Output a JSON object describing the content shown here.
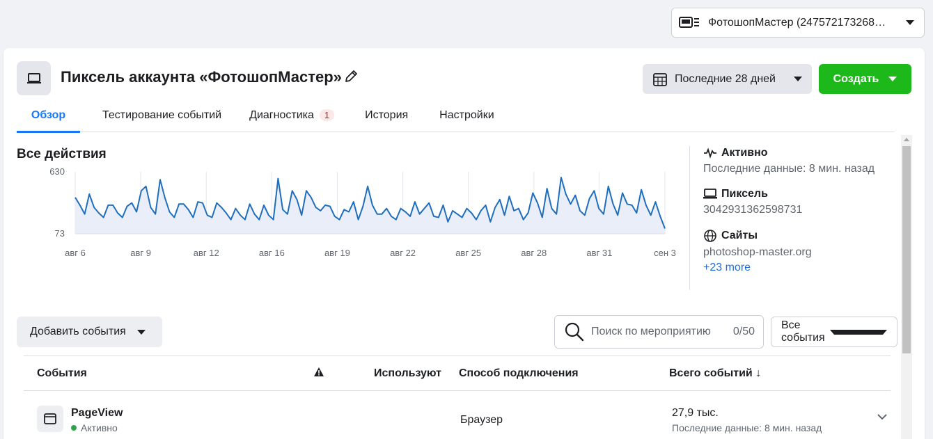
{
  "account_selector": {
    "label": "ФотошопМастер (247572173268…"
  },
  "header": {
    "title": "Пиксель аккаунта «ФотошопМастер»",
    "date_range": "Последние 28 дней",
    "create_label": "Создать"
  },
  "tabs": [
    {
      "label": "Обзор",
      "active": true
    },
    {
      "label": "Тестирование событий"
    },
    {
      "label": "Диагностика",
      "badge": "1"
    },
    {
      "label": "История"
    },
    {
      "label": "Настройки"
    }
  ],
  "chart_data": {
    "type": "area",
    "title": "Все действия",
    "ylim": [
      73,
      630
    ],
    "ytick_labels": [
      "630",
      "73"
    ],
    "xtick_labels": [
      "авг 6",
      "авг 9",
      "авг 12",
      "авг 16",
      "авг 19",
      "авг 22",
      "авг 25",
      "авг 28",
      "авг 31",
      "сен 3"
    ],
    "line_color": "#1f6ebd",
    "fill_color": "#e9eef9",
    "values": [
      400,
      330,
      250,
      430,
      310,
      260,
      220,
      330,
      330,
      260,
      220,
      320,
      350,
      270,
      460,
      500,
      310,
      250,
      560,
      400,
      270,
      220,
      340,
      340,
      290,
      220,
      360,
      350,
      240,
      220,
      350,
      310,
      260,
      200,
      300,
      240,
      200,
      340,
      250,
      200,
      330,
      240,
      200,
      570,
      290,
      250,
      460,
      380,
      240,
      460,
      400,
      310,
      280,
      330,
      320,
      230,
      200,
      290,
      270,
      360,
      200,
      320,
      500,
      330,
      250,
      250,
      300,
      230,
      200,
      300,
      270,
      230,
      360,
      250,
      300,
      350,
      230,
      220,
      330,
      180,
      280,
      250,
      220,
      300,
      260,
      200,
      280,
      330,
      180,
      310,
      380,
      240,
      410,
      280,
      300,
      200,
      260,
      440,
      350,
      220,
      480,
      300,
      250,
      580,
      430,
      340,
      420,
      280,
      240,
      390,
      460,
      300,
      250,
      500,
      340,
      240,
      440,
      340,
      330,
      260,
      470,
      330,
      240,
      360,
      230,
      120
    ]
  },
  "status": {
    "active_title": "Активно",
    "active_sub": "Последние данные: 8 мин. назад",
    "pixel_title": "Пиксель",
    "pixel_id": "3042931362598731",
    "sites_title": "Сайты",
    "site": "photoshop-master.org",
    "more_link": "+23 more"
  },
  "toolbar": {
    "add_events": "Добавить события",
    "search_placeholder": "Поиск по мероприятию",
    "search_count": "0/50",
    "filter": "Все события"
  },
  "table": {
    "headers": {
      "events": "События",
      "used_by": "Используют",
      "method": "Способ подключения",
      "total": "Всего событий"
    },
    "rows": [
      {
        "name": "PageView",
        "status": "Активно",
        "method": "Браузер",
        "total": "27,9 тыс.",
        "last": "Последние данные: 8 мин. назад"
      }
    ]
  }
}
